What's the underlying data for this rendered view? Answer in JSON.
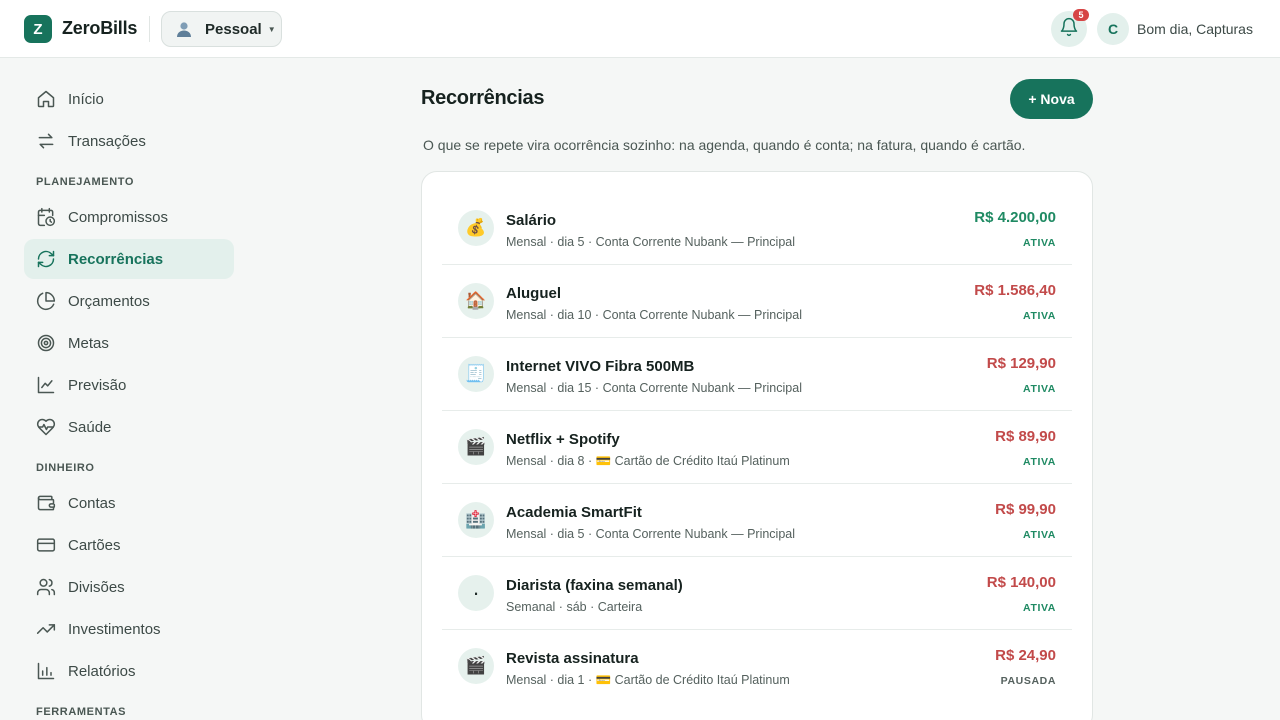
{
  "header": {
    "logo_letter": "Z",
    "app_name": "ZeroBills",
    "profile_name": "Pessoal",
    "profile_icon": "person-avatar-icon",
    "notification_count": "5",
    "user_initial": "C",
    "greeting": "Bom dia, Capturas"
  },
  "sidebar": {
    "top_items": [
      {
        "label": "Início",
        "icon": "home-icon"
      },
      {
        "label": "Transações",
        "icon": "swap-arrows-icon"
      }
    ],
    "sections": [
      {
        "title": "PLANEJAMENTO",
        "items": [
          {
            "label": "Compromissos",
            "icon": "calendar-clock-icon"
          },
          {
            "label": "Recorrências",
            "icon": "refresh-icon",
            "active": true
          },
          {
            "label": "Orçamentos",
            "icon": "pie-chart-icon"
          },
          {
            "label": "Metas",
            "icon": "target-icon"
          },
          {
            "label": "Previsão",
            "icon": "line-chart-icon"
          },
          {
            "label": "Saúde",
            "icon": "heart-pulse-icon"
          }
        ]
      },
      {
        "title": "DINHEIRO",
        "items": [
          {
            "label": "Contas",
            "icon": "wallet-icon"
          },
          {
            "label": "Cartões",
            "icon": "credit-card-icon"
          },
          {
            "label": "Divisões",
            "icon": "users-icon"
          },
          {
            "label": "Investimentos",
            "icon": "trending-up-icon"
          },
          {
            "label": "Relatórios",
            "icon": "bar-chart-icon"
          }
        ]
      },
      {
        "title": "FERRAMENTAS",
        "items": []
      }
    ]
  },
  "main": {
    "title": "Recorrências",
    "new_button": "+ Nova",
    "subtitle": "O que se repete vira ocorrência sozinho: na agenda, quando é conta; na fatura, quando é cartão.",
    "recurrences": [
      {
        "icon": "💰",
        "icon_name": "money-bag-icon",
        "name": "Salário",
        "meta": "Mensal · dia 5 · Conta Corrente Nubank — Principal",
        "amount": "R$ 4.200,00",
        "kind": "income",
        "status": "ATIVA"
      },
      {
        "icon": "🏠",
        "icon_name": "house-icon",
        "name": "Aluguel",
        "meta": "Mensal · dia 10 · Conta Corrente Nubank — Principal",
        "amount": "R$ 1.586,40",
        "kind": "expense",
        "status": "ATIVA"
      },
      {
        "icon": "🧾",
        "icon_name": "receipt-icon",
        "name": "Internet VIVO Fibra 500MB",
        "meta": "Mensal · dia 15 · Conta Corrente Nubank — Principal",
        "amount": "R$ 129,90",
        "kind": "expense",
        "status": "ATIVA"
      },
      {
        "icon": "🎬",
        "icon_name": "clapperboard-icon",
        "name": "Netflix + Spotify",
        "meta": "Mensal · dia 8 · 💳 Cartão de Crédito Itaú Platinum",
        "amount": "R$ 89,90",
        "kind": "expense",
        "status": "ATIVA"
      },
      {
        "icon": "🏥",
        "icon_name": "hospital-icon",
        "name": "Academia SmartFit",
        "meta": "Mensal · dia 5 · Conta Corrente Nubank — Principal",
        "amount": "R$ 99,90",
        "kind": "expense",
        "status": "ATIVA"
      },
      {
        "icon": "·",
        "icon_name": "dot-icon",
        "name": "Diarista (faxina semanal)",
        "meta": "Semanal · sáb · Carteira",
        "amount": "R$ 140,00",
        "kind": "expense",
        "status": "ATIVA"
      },
      {
        "icon": "🎬",
        "icon_name": "clapperboard-icon",
        "name": "Revista assinatura",
        "meta": "Mensal · dia 1 · 💳 Cartão de Crédito Itaú Platinum",
        "amount": "R$ 24,90",
        "kind": "expense",
        "status": "PAUSADA"
      }
    ]
  },
  "colors": {
    "brand": "#17735c",
    "income": "#1f8a63",
    "expense": "#c24a4a",
    "badge": "#d64545"
  }
}
